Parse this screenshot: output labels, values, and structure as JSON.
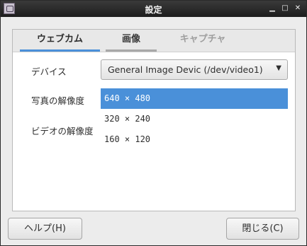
{
  "window": {
    "title": "設定"
  },
  "tabs": [
    {
      "label": "ウェブカム",
      "state": "active"
    },
    {
      "label": "画像",
      "state": "normal"
    },
    {
      "label": "キャプチャ",
      "state": "disabled"
    }
  ],
  "device": {
    "label": "デバイス",
    "value": "General Image Devic (/dev/video1)"
  },
  "photo_resolution": {
    "label": "写真の解像度"
  },
  "video_resolution": {
    "label": "ビデオの解像度"
  },
  "resolutions": [
    {
      "text": "640 × 480",
      "selected": true
    },
    {
      "text": "320 × 240",
      "selected": false
    },
    {
      "text": "160 × 120",
      "selected": false
    }
  ],
  "buttons": {
    "help": "ヘルプ(H)",
    "close": "閉じる(C)"
  },
  "icons": {
    "app": "webcam-app-icon",
    "dropdown": "dropdown-arrow-icon",
    "minimize": "minimize-icon",
    "maximize": "maximize-icon",
    "close": "close-icon"
  },
  "colors": {
    "accent": "#4a90d9",
    "titlebar": "#2b2b2b"
  }
}
